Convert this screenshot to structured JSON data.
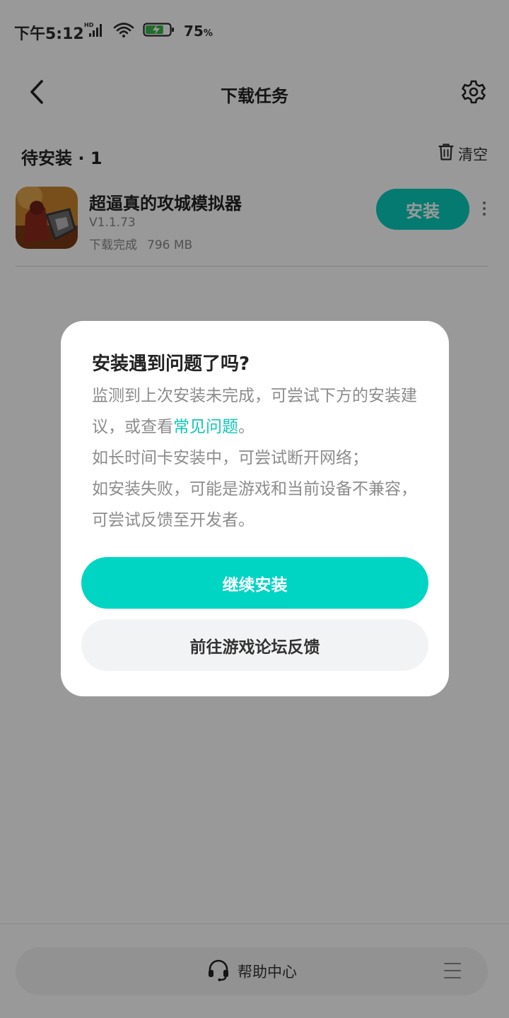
{
  "status_bar": {
    "time": "下午5:12",
    "battery_percent": "75",
    "battery_unit": "%",
    "battery_level": 0.75
  },
  "header": {
    "title": "下载任务",
    "back_icon": "chevron-left-icon",
    "settings_icon": "gear-icon"
  },
  "section": {
    "title": "待安装",
    "count": "1",
    "clear_label": "清空",
    "clear_icon": "trash-icon"
  },
  "app": {
    "name": "超逼真的攻城模拟器",
    "version": "V1.1.73",
    "status": "下载完成",
    "size": "796 MB",
    "install_label": "安装"
  },
  "footer": {
    "help_label": "帮助中心",
    "help_icon": "headset-icon",
    "menu_icon": "menu-icon"
  },
  "dialog": {
    "title": "安装遇到问题了吗?",
    "line1_prefix": "监测到上次安装未完成，可尝试下方的安装建议，或查看",
    "faq_link": "常见问题",
    "line1_suffix": "。",
    "line2": "如长时间卡安装中，可尝试断开网络；",
    "line3": "如安装失败，可能是游戏和当前设备不兼容，可尝试反馈至开发者。",
    "continue_label": "继续安装",
    "forum_label": "前往游戏论坛反馈"
  },
  "colors": {
    "accent": "#00d5c4",
    "install_button": "#08ccbb",
    "link": "#12c7b7"
  }
}
